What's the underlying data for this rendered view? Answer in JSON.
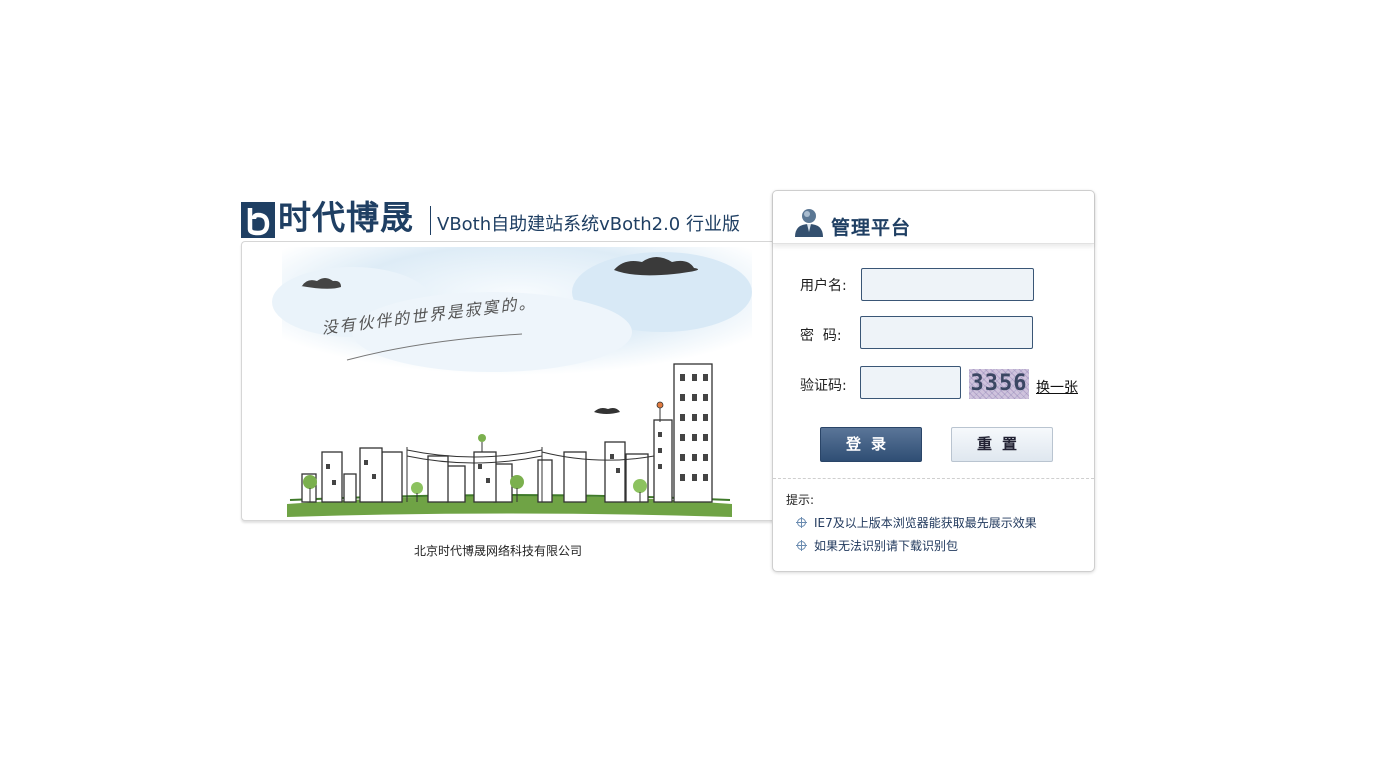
{
  "brand": {
    "name": "时代博晟",
    "subtitle": "VBoth自助建站系统vBoth2.0 行业版"
  },
  "illustration": {
    "slogan": "没有伙伴的世界是寂寞的。"
  },
  "company": "北京时代博晟网络科技有限公司",
  "login": {
    "title": "管理平台",
    "username_label": "用户名:",
    "username_value": "",
    "password_label": "密  码:",
    "password_value": "",
    "captcha_label": "验证码:",
    "captcha_value": "",
    "captcha_text": "3356",
    "refresh_label": "换一张",
    "login_button": "登录",
    "reset_button": "重置"
  },
  "tips": {
    "label": "提示:",
    "items": [
      "IE7及以上版本浏览器能获取最先展示效果",
      "如果无法识别请下载识别包"
    ]
  },
  "colors": {
    "brand": "#1f3f63",
    "button_primary": "#2f4e74",
    "field_bg": "#eef3f8"
  }
}
